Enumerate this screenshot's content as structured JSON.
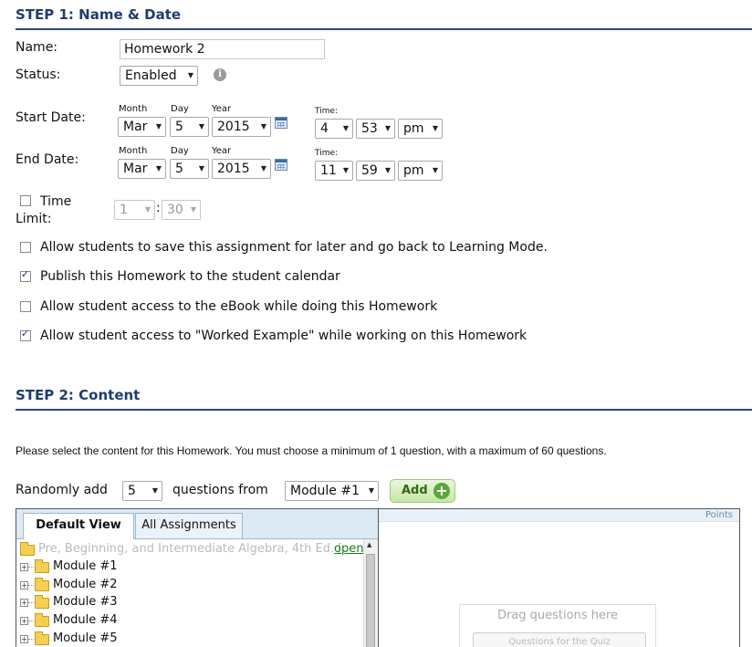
{
  "step1": {
    "title": "STEP 1: Name & Date"
  },
  "name": {
    "label": "Name:",
    "value": "Homework 2"
  },
  "status": {
    "label": "Status:",
    "value": "Enabled"
  },
  "date_headers": {
    "month": "Month",
    "day": "Day",
    "year": "Year",
    "time": "Time:"
  },
  "start": {
    "label": "Start Date:",
    "month": "Mar",
    "day": "5",
    "year": "2015",
    "hour": "4",
    "minute": "53",
    "ampm": "pm"
  },
  "end": {
    "label": "End Date:",
    "month": "Mar",
    "day": "5",
    "year": "2015",
    "hour": "11",
    "minute": "59",
    "ampm": "pm"
  },
  "time_limit": {
    "label_line1": "Time",
    "label_line2": "Limit:",
    "hours": "1",
    "separator": ":",
    "minutes": "30",
    "checked": false
  },
  "options": [
    {
      "label": "Allow students to save this assignment for later and go back to Learning Mode.",
      "checked": false
    },
    {
      "label": "Publish this Homework to the student calendar",
      "checked": true
    },
    {
      "label": "Allow student access to the eBook while doing this Homework",
      "checked": false
    },
    {
      "label": "Allow student access to \"Worked Example\" while working on this Homework",
      "checked": true
    }
  ],
  "step2": {
    "title": "STEP 2: Content",
    "instructions": "Please select the content for this Homework. You must choose a minimum of 1 question, with a maximum of 60 questions.",
    "random_label": "Randomly add",
    "random_count": "5",
    "questions_from": "questions from",
    "module": "Module #1",
    "add_label": "Add"
  },
  "tabs": [
    {
      "label": "Default View",
      "active": true
    },
    {
      "label": "All Assignments",
      "active": false
    }
  ],
  "tree": {
    "root": "Pre, Beginning, and Intermediate Algebra, 4th Ed. [",
    "root_link": "open",
    "items": [
      "Module #1",
      "Module #2",
      "Module #3",
      "Module #4",
      "Module #5"
    ]
  },
  "right_panel": {
    "points": "Points",
    "drag_text": "Drag questions here",
    "button": "Questions for the Quiz"
  },
  "colors": {
    "heading": "#1f3d6b",
    "accent_green": "#5aa83a",
    "link": "#1a7a1a"
  }
}
